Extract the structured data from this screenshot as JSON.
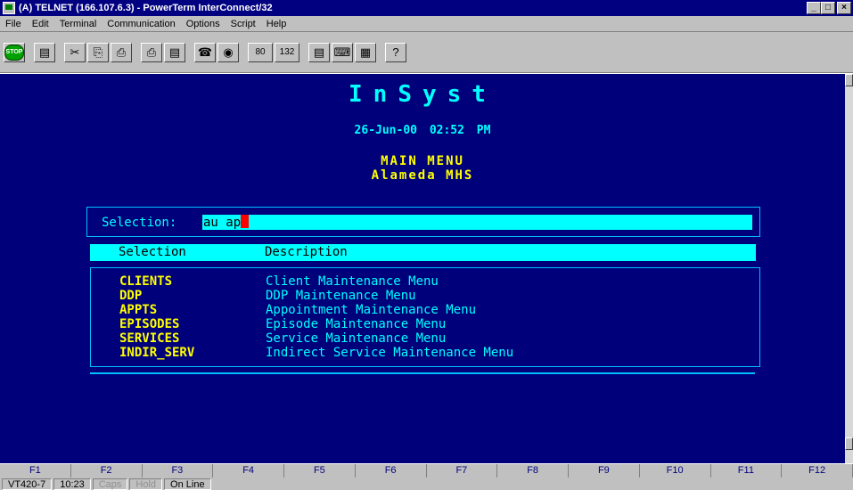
{
  "window": {
    "title": "(A) TELNET (166.107.6.3) - PowerTerm InterConnect/32",
    "buttons": [
      "_",
      "□",
      "×"
    ]
  },
  "menu": [
    "File",
    "Edit",
    "Terminal",
    "Communication",
    "Options",
    "Script",
    "Help"
  ],
  "toolbar": {
    "stop_label": "STOP",
    "cols80": "80",
    "cols132": "132",
    "help_label": "?"
  },
  "screen": {
    "app_title": "InSyst",
    "date": "26-Jun-00",
    "time": "02:52 PM",
    "menu_title": "MAIN MENU",
    "subtitle": "Alameda MHS",
    "selection_label": "Selection:",
    "selection_value": "au ap",
    "col_selection": "Selection",
    "col_description": "Description",
    "items": [
      {
        "code": "CLIENTS",
        "desc": "Client Maintenance Menu"
      },
      {
        "code": "DDP",
        "desc": "DDP Maintenance Menu"
      },
      {
        "code": "APPTS",
        "desc": "Appointment Maintenance Menu"
      },
      {
        "code": "EPISODES",
        "desc": "Episode Maintenance Menu"
      },
      {
        "code": "SERVICES",
        "desc": "Service Maintenance Menu"
      },
      {
        "code": "INDIR_SERV",
        "desc": "Indirect Service Maintenance Menu"
      }
    ]
  },
  "fkeys": [
    "F1",
    "F2",
    "F3",
    "F4",
    "F5",
    "F6",
    "F7",
    "F8",
    "F9",
    "F10",
    "F11",
    "F12"
  ],
  "status": {
    "terminal_type": "VT420-7",
    "cursor_pos": "10:23",
    "caps": "Caps",
    "hold": "Hold",
    "online": "On Line"
  },
  "colors": {
    "terminal_bg": "#00007a",
    "cyan": "#00ffff",
    "yellow": "#ffff00",
    "cursor": "#ff0000"
  }
}
